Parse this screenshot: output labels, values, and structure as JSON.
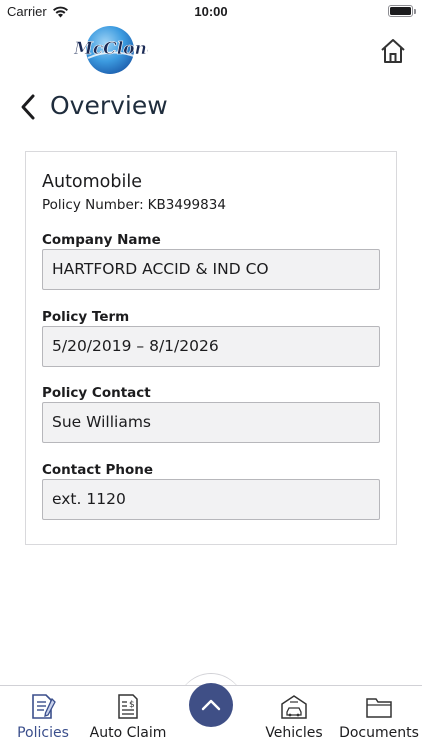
{
  "status_bar": {
    "carrier": "Carrier",
    "time": "10:00"
  },
  "header": {
    "logo_text": "McClone",
    "home_icon": "home-icon"
  },
  "title": {
    "back_icon": "chevron-left-icon",
    "text": "Overview"
  },
  "policy": {
    "type": "Automobile",
    "number_label": "Policy Number:",
    "number": "KB3499834",
    "fields": [
      {
        "label": "Company Name",
        "value": "HARTFORD ACCID & IND CO"
      },
      {
        "label": "Policy Term",
        "value": "5/20/2019 – 8/1/2026"
      },
      {
        "label": "Policy Contact",
        "value": "Sue Williams"
      },
      {
        "label": "Contact Phone",
        "value": "ext. 1120"
      }
    ]
  },
  "tab_bar": {
    "tabs": [
      {
        "label": "Policies",
        "icon": "policy-document-icon",
        "active": true
      },
      {
        "label": "Auto Claim",
        "icon": "claim-form-icon",
        "active": false
      },
      {
        "label": "Vehicles",
        "icon": "garage-car-icon",
        "active": false
      },
      {
        "label": "Documents",
        "icon": "folder-icon",
        "active": false
      }
    ],
    "center_button_icon": "chevron-up-icon"
  },
  "colors": {
    "accent": "#3f4f86",
    "active_tab": "#3b4f8c",
    "field_bg": "#f2f2f3",
    "logo_blue": "#2a7fd0"
  }
}
